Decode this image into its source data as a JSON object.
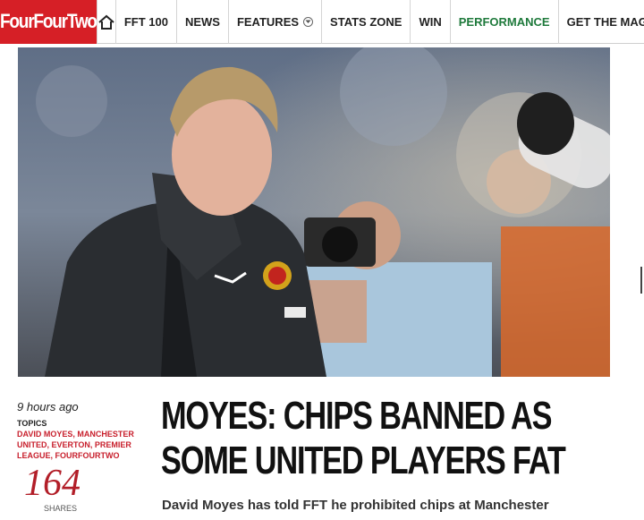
{
  "nav": {
    "logo": "FourFourTwo",
    "home_icon": "home-icon",
    "items": [
      {
        "label": "FFT 100"
      },
      {
        "label": "NEWS"
      },
      {
        "label": "FEATURES",
        "icon": "chevron-down-icon"
      },
      {
        "label": "STATS ZONE"
      },
      {
        "label": "WIN"
      },
      {
        "label": "PERFORMANCE",
        "color": "#1f7a3c"
      },
      {
        "label": "GET THE MAG"
      }
    ]
  },
  "article": {
    "time": "9 hours ago",
    "topics_label": "TOPICS",
    "topics": "DAVID MOYES, MANCHESTER UNITED, EVERTON, PREMIER LEAGUE, FOURFOURTWO",
    "shares_count": "164",
    "shares_label": "SHARES",
    "headline_line1": "MOYES: CHIPS BANNED AS",
    "headline_line2": "SOME UNITED PLAYERS FAT",
    "standfirst": "David Moyes has told FFT he prohibited chips at Manchester"
  },
  "colors": {
    "brand_red": "#d61f26",
    "performance_green": "#1f7a3c",
    "topics_red": "#c8202d",
    "shares_red": "#b21e28"
  }
}
